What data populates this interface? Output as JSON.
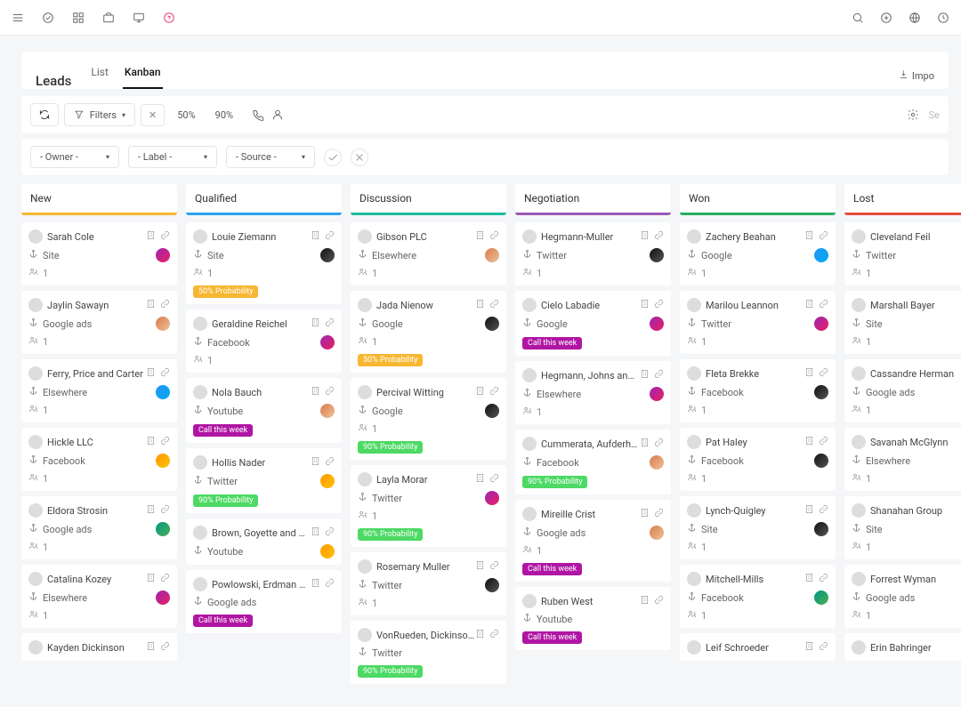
{
  "topbar": {
    "import": "Impo"
  },
  "page": {
    "title": "Leads"
  },
  "tabs": {
    "list": "List",
    "kanban": "Kanban"
  },
  "toolbar": {
    "filters": "Filters",
    "p50": "50%",
    "p90": "90%",
    "search_ph": "Se"
  },
  "selects": {
    "owner": "- Owner -",
    "label": "- Label -",
    "source": "- Source -"
  },
  "columns": [
    {
      "name": "New",
      "color": "#f7b731",
      "cards": [
        {
          "title": "Sarah Cole",
          "type": "person",
          "source": "Site",
          "count": "1",
          "avatar": "c0"
        },
        {
          "title": "Jaylin Sawayn",
          "type": "person",
          "source": "Google ads",
          "count": "1",
          "avatar": "c5"
        },
        {
          "title": "Ferry, Price and Carter",
          "type": "company",
          "source": "Elsewhere",
          "count": "1",
          "avatar": "c1"
        },
        {
          "title": "Hickle LLC",
          "type": "company",
          "source": "Facebook",
          "count": "1",
          "avatar": "c2"
        },
        {
          "title": "Eldora Strosin",
          "type": "person",
          "source": "Google ads",
          "count": "1",
          "avatar": "c4"
        },
        {
          "title": "Catalina Kozey",
          "type": "person",
          "source": "Elsewhere",
          "count": "1",
          "avatar": "c0"
        },
        {
          "title": "Kayden Dickinson",
          "type": "person",
          "source": "",
          "count": "",
          "avatar": null
        }
      ]
    },
    {
      "name": "Qualified",
      "color": "#2aa3ef",
      "cards": [
        {
          "title": "Louie Ziemann",
          "type": "person",
          "source": "Site",
          "count": "1",
          "avatar": "c3",
          "badge": {
            "cls": "p50",
            "text": "50% Probability"
          }
        },
        {
          "title": "Geraldine Reichel",
          "type": "person",
          "source": "Facebook",
          "count": "1",
          "avatar": "c0"
        },
        {
          "title": "Nola Bauch",
          "type": "person",
          "source": "Youtube",
          "count": "",
          "avatar": "c5",
          "badge": {
            "cls": "call",
            "text": "Call this week"
          }
        },
        {
          "title": "Hollis Nader",
          "type": "person",
          "source": "Twitter",
          "count": "",
          "avatar": "c2",
          "badge": {
            "cls": "p90",
            "text": "90% Probability"
          }
        },
        {
          "title": "Brown, Goyette and Gusikowski",
          "type": "company",
          "source": "Youtube",
          "count": "",
          "avatar": "c2"
        },
        {
          "title": "Powlowski, Erdman and Wilderman",
          "type": "company",
          "source": "Google ads",
          "count": "",
          "avatar": null,
          "badge": {
            "cls": "call",
            "text": "Call this week"
          }
        }
      ]
    },
    {
      "name": "Discussion",
      "color": "#1abc9c",
      "cards": [
        {
          "title": "Gibson PLC",
          "type": "company",
          "source": "Elsewhere",
          "count": "1",
          "avatar": "c5"
        },
        {
          "title": "Jada Nienow",
          "type": "person",
          "source": "Google",
          "count": "1",
          "avatar": "c3",
          "badge": {
            "cls": "p50",
            "text": "50% Probability"
          }
        },
        {
          "title": "Percival Witting",
          "type": "person",
          "source": "Google",
          "count": "1",
          "avatar": "c3",
          "badge": {
            "cls": "p90",
            "text": "90% Probability"
          }
        },
        {
          "title": "Layla Morar",
          "type": "person",
          "source": "Twitter",
          "count": "1",
          "avatar": "c0",
          "badge": {
            "cls": "p90",
            "text": "90% Probability"
          }
        },
        {
          "title": "Rosemary Muller",
          "type": "person",
          "source": "Twitter",
          "count": "1",
          "avatar": "c3"
        },
        {
          "title": "VonRueden, Dickinson and Macejkovic",
          "type": "company",
          "source": "Twitter",
          "count": "",
          "avatar": null,
          "badge": {
            "cls": "p90",
            "text": "90% Probability"
          }
        }
      ]
    },
    {
      "name": "Negotiation",
      "color": "#9b59b6",
      "cards": [
        {
          "title": "Hegmann-Muller",
          "type": "company",
          "source": "Twitter",
          "count": "1",
          "avatar": "c3"
        },
        {
          "title": "Cielo Labadie",
          "type": "person",
          "source": "Google",
          "count": "",
          "avatar": "c0",
          "badge": {
            "cls": "call",
            "text": "Call this week"
          }
        },
        {
          "title": "Hegmann, Johns and Ankunding",
          "type": "company",
          "source": "Elsewhere",
          "count": "1",
          "avatar": "c0"
        },
        {
          "title": "Cummerata, Aufderhar and Bergnaum",
          "type": "company",
          "source": "Facebook",
          "count": "",
          "avatar": "c5",
          "badge": {
            "cls": "p90",
            "text": "90% Probability"
          }
        },
        {
          "title": "Mireille Crist",
          "type": "person",
          "source": "Google ads",
          "count": "1",
          "avatar": "c5",
          "badge": {
            "cls": "call",
            "text": "Call this week"
          }
        },
        {
          "title": "Ruben West",
          "type": "person",
          "source": "Youtube",
          "count": "",
          "avatar": null,
          "badge": {
            "cls": "call",
            "text": "Call this week"
          }
        }
      ]
    },
    {
      "name": "Won",
      "color": "#27ae60",
      "cards": [
        {
          "title": "Zachery Beahan",
          "type": "person",
          "source": "Google",
          "count": "1",
          "avatar": "c1"
        },
        {
          "title": "Marilou Leannon",
          "type": "person",
          "source": "Twitter",
          "count": "1",
          "avatar": "c0"
        },
        {
          "title": "Fleta Brekke",
          "type": "person",
          "source": "Facebook",
          "count": "1",
          "avatar": "c3"
        },
        {
          "title": "Pat Haley",
          "type": "person",
          "source": "Facebook",
          "count": "1",
          "avatar": "c3"
        },
        {
          "title": "Lynch-Quigley",
          "type": "company",
          "source": "Site",
          "count": "1",
          "avatar": "c3"
        },
        {
          "title": "Mitchell-Mills",
          "type": "company",
          "source": "Facebook",
          "count": "1",
          "avatar": "c4"
        },
        {
          "title": "Leif Schroeder",
          "type": "person",
          "source": "",
          "count": "",
          "avatar": null
        }
      ]
    },
    {
      "name": "Lost",
      "color": "#e74c3c",
      "cards": [
        {
          "title": "Cleveland Feil",
          "type": "person",
          "source": "Twitter",
          "count": "1",
          "avatar": "c2"
        },
        {
          "title": "Marshall Bayer",
          "type": "person",
          "source": "Site",
          "count": "1",
          "avatar": "c3"
        },
        {
          "title": "Cassandre Herman",
          "type": "person",
          "source": "Google ads",
          "count": "1",
          "avatar": "c0"
        },
        {
          "title": "Savanah McGlynn",
          "type": "person",
          "source": "Elsewhere",
          "count": "1",
          "avatar": "c2"
        },
        {
          "title": "Shanahan Group",
          "type": "company",
          "source": "Site",
          "count": "1",
          "avatar": "c1"
        },
        {
          "title": "Forrest Wyman",
          "type": "person",
          "source": "Google ads",
          "count": "1",
          "avatar": "c1"
        },
        {
          "title": "Erin Bahringer",
          "type": "person",
          "source": "",
          "count": "",
          "avatar": null
        }
      ]
    }
  ]
}
